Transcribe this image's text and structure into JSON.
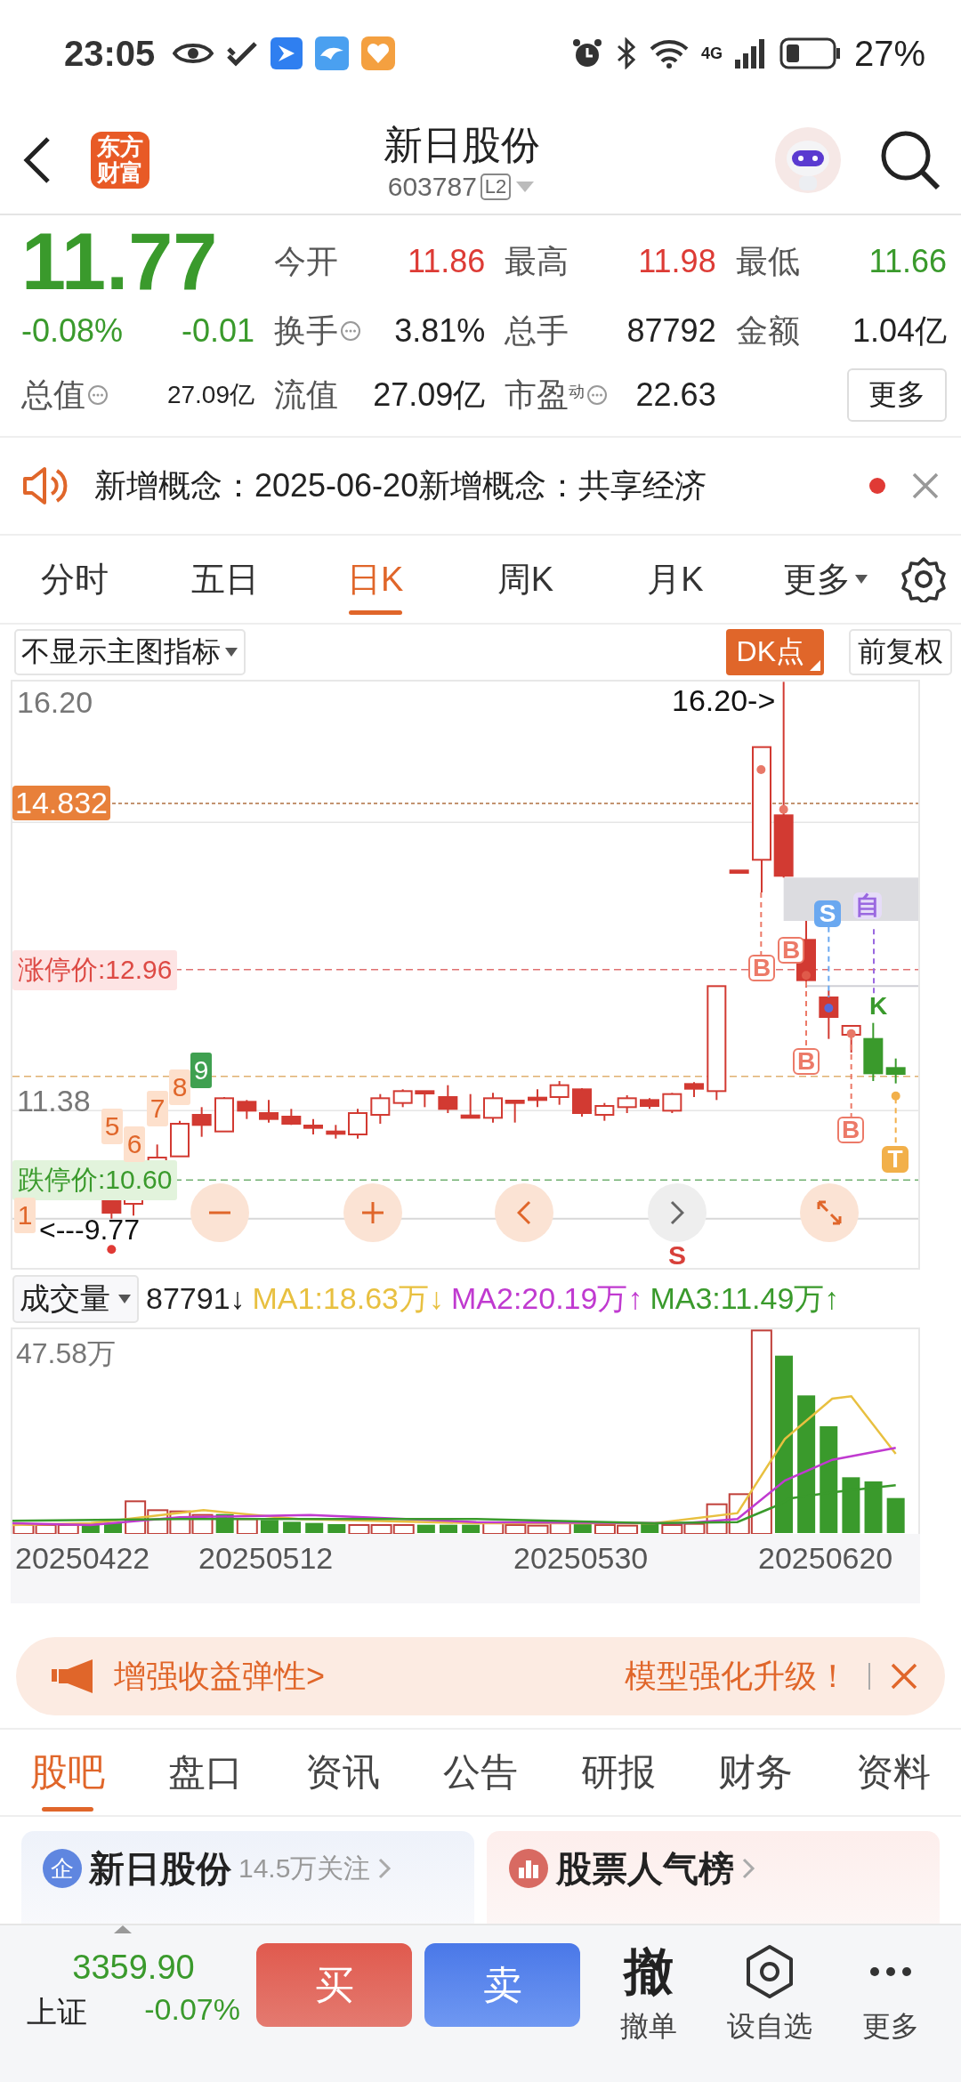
{
  "status_bar": {
    "time": "23:05",
    "network": "4G",
    "battery": "27%"
  },
  "header": {
    "logo": "东方财富",
    "title": "新日股份",
    "code": "603787",
    "badge": "L2"
  },
  "quote": {
    "price": "11.77",
    "change_pct": "-0.08%",
    "change": "-0.01",
    "market_cap": {
      "label": "总值",
      "value": "27.09亿",
      "info": true
    },
    "stats": [
      {
        "label": "今开",
        "value": "11.86",
        "color": "#dd3b35"
      },
      {
        "label": "最高",
        "value": "11.98",
        "color": "#dd3b35"
      },
      {
        "label": "最低",
        "value": "11.66",
        "color": "#3a9a2c"
      },
      {
        "label": "换手",
        "value": "3.81%",
        "info": true
      },
      {
        "label": "总手",
        "value": "87792"
      },
      {
        "label": "金额",
        "value": "1.04亿"
      },
      {
        "label": "流值",
        "value": "27.09亿"
      },
      {
        "label": "市盈",
        "sup": "动",
        "value": "22.63",
        "info": true
      }
    ],
    "more": "更多"
  },
  "notice": {
    "text": "新增概念：2025-06-20新增概念：共享经济",
    "unread": true
  },
  "period_tabs": [
    {
      "label": "分时",
      "selected": false,
      "kind": "tab"
    },
    {
      "label": "五日",
      "selected": false,
      "kind": "tab"
    },
    {
      "label": "日K",
      "selected": true,
      "kind": "tab"
    },
    {
      "label": "周K",
      "selected": false,
      "kind": "tab"
    },
    {
      "label": "月K",
      "selected": false,
      "kind": "tab"
    },
    {
      "label": "更多",
      "selected": false,
      "kind": "menu"
    }
  ],
  "chart_toolbar": {
    "indicator": "不显示主图指标",
    "dk": "DK点",
    "adjust": "前复权"
  },
  "kline": {
    "axis_labels": [
      "16.20",
      "11.38"
    ],
    "high_label": "16.20->",
    "low_label": "<---9.77",
    "cost_tag": "14.832",
    "limit_up": "涨停价:12.96",
    "limit_down": "跌停价:10.60",
    "counts": [
      {
        "text": "1",
        "kind": "setup"
      },
      {
        "text": "5",
        "kind": "setup"
      },
      {
        "text": "6",
        "kind": "setup"
      },
      {
        "text": "7",
        "kind": "setup"
      },
      {
        "text": "8",
        "kind": "setup"
      },
      {
        "text": "9",
        "kind": "end"
      }
    ],
    "signals": [
      {
        "text": "B",
        "kind": "buy"
      },
      {
        "text": "B",
        "kind": "buy"
      },
      {
        "text": "B",
        "kind": "buy"
      },
      {
        "text": "B",
        "kind": "buy"
      },
      {
        "text": "S",
        "kind": "sell"
      },
      {
        "text": "自",
        "kind": "custom"
      },
      {
        "text": "K",
        "kind": "k"
      },
      {
        "text": "T",
        "kind": "t"
      }
    ],
    "s_mark": "S"
  },
  "volume": {
    "selector": "成交量",
    "value": "87791↓",
    "ma": [
      {
        "text": "MA1:18.63万↓",
        "color": "#e8c040"
      },
      {
        "text": "MA2:20.19万↑",
        "color": "#c03ad0"
      },
      {
        "text": "MA3:11.49万↑",
        "color": "#3a9a2c"
      }
    ],
    "max_label": "47.58万",
    "dates": [
      "20250422",
      "20250512",
      "20250530",
      "20250620"
    ]
  },
  "banner": {
    "left": "增强收益弹性>",
    "right": "模型强化升级！"
  },
  "section_tabs": [
    {
      "label": "股吧",
      "selected": true
    },
    {
      "label": "盘口",
      "selected": false
    },
    {
      "label": "资讯",
      "selected": false
    },
    {
      "label": "公告",
      "selected": false
    },
    {
      "label": "研报",
      "selected": false
    },
    {
      "label": "财务",
      "selected": false
    },
    {
      "label": "资料",
      "selected": false
    }
  ],
  "cards": [
    {
      "kind": "company",
      "badge": "企",
      "title": "新日股份",
      "meta": "14.5万关注"
    },
    {
      "kind": "ranking",
      "title": "股票人气榜"
    }
  ],
  "bottom_bar": {
    "index_value": "3359.90",
    "index_name": "上证",
    "index_change": "-0.07%",
    "buy": "买",
    "sell": "卖",
    "actions": [
      {
        "kind": "cancel",
        "glyph": "撤",
        "label": "撤单"
      },
      {
        "kind": "watch",
        "label": "设自选"
      },
      {
        "kind": "more",
        "label": "更多"
      }
    ]
  }
}
